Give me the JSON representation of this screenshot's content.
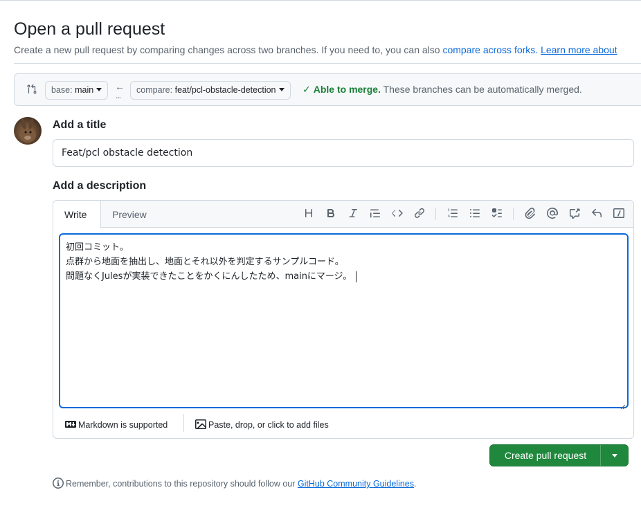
{
  "header": {
    "title": "Open a pull request",
    "subtitle_text": "Create a new pull request by comparing changes across two branches. If you need to, you can also ",
    "compare_forks_link": "compare across forks.",
    "learn_more_link": "Learn more about"
  },
  "range": {
    "base_label": "base:",
    "base_value": "main",
    "compare_label": "compare:",
    "compare_value": "feat/pcl-obstacle-detection",
    "merge_strong": "Able to merge.",
    "merge_text": "These branches can be automatically merged."
  },
  "form": {
    "title_label": "Add a title",
    "title_value": "Feat/pcl obstacle detection",
    "description_label": "Add a description",
    "tabs": [
      "Write",
      "Preview"
    ],
    "body_lines": [
      "初回コミット。",
      "点群から地面を抽出し、地面とそれ以外を判定するサンプルコード。",
      "問題なくJulesが実装できたことをかくにんしたため、mainにマージ。"
    ],
    "markdown_note": "Markdown is supported",
    "attach_note": "Paste, drop, or click to add files"
  },
  "actions": {
    "create_label": "Create pull request"
  },
  "footer": {
    "remember_text": "Remember, contributions to this repository should follow our ",
    "guidelines_link": "GitHub Community Guidelines",
    "period": "."
  },
  "colors": {
    "accent": "#0969da",
    "success": "#1a7f37",
    "primary_button": "#1f883d",
    "border": "#d1d9e0"
  },
  "icons": [
    "compare-icon",
    "arrow-left-icon",
    "check-icon",
    "heading-icon",
    "bold-icon",
    "italic-icon",
    "quote-icon",
    "code-icon",
    "link-icon",
    "ordered-list-icon",
    "unordered-list-icon",
    "task-list-icon",
    "attach-icon",
    "mention-icon",
    "cross-reference-icon",
    "undo-icon",
    "slash-command-icon",
    "markdown-icon",
    "image-icon",
    "info-icon"
  ]
}
